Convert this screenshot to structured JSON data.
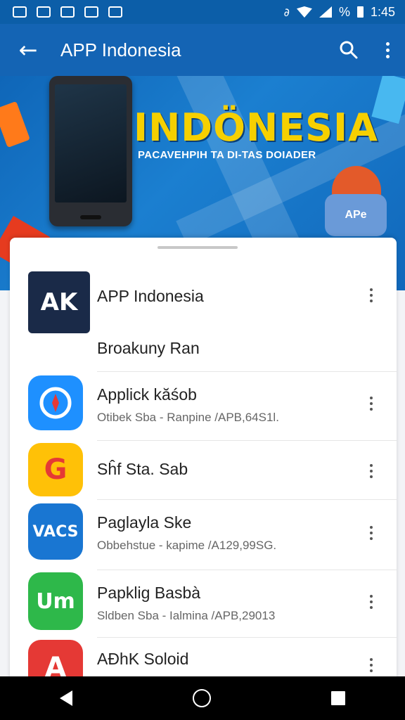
{
  "status_bar": {
    "time": "1:45",
    "percent_label": "%"
  },
  "app_bar": {
    "title": "APP Indonesia"
  },
  "banner": {
    "title": "INDÖNESIA",
    "subtitle": "PACAVEHPIH TA DI-TAS DOIADER",
    "mascot_label": "APe"
  },
  "featured": {
    "name": "APP Indonesia",
    "subtitle": "Broakuny Ran",
    "icon_text": "AK"
  },
  "apps": [
    {
      "name": "Applick kăśob",
      "subtitle": "Otibek Sba - Ranpine /APB,64S1l.",
      "icon": "compass-icon",
      "icon_text": "",
      "color": "#1e90ff"
    },
    {
      "name": "Sĥf Sta. Sab",
      "subtitle": "",
      "icon": "swirl-icon",
      "icon_text": "G",
      "color": "#ffc107"
    },
    {
      "name": "Paglayla Ske",
      "subtitle": "Obbehstue - kapime /A129,99SG.",
      "icon": "vacs-icon",
      "icon_text": "VACS",
      "color": "#1976d2"
    },
    {
      "name": "Papklig Basbà",
      "subtitle": "Sldben Sba - Ialmina /APB,29013",
      "icon": "um-icon",
      "icon_text": "Um",
      "color": "#2eb84a"
    },
    {
      "name": "AĐhK Soloid",
      "subtitle": "",
      "icon": "a-icon",
      "icon_text": "A",
      "color": "#e53935"
    }
  ]
}
